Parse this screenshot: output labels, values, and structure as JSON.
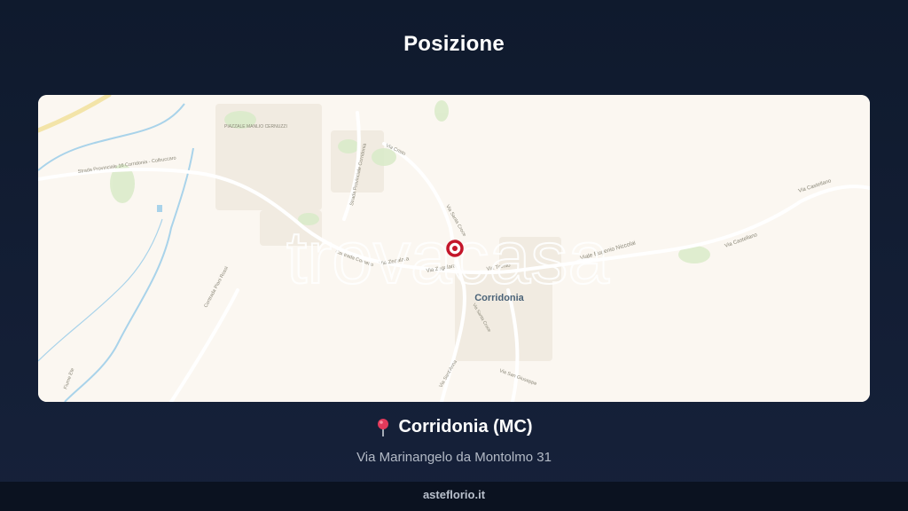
{
  "page": {
    "title": "Posizione"
  },
  "map": {
    "watermark": "trovacasa",
    "town_label": "Corridonia",
    "labels": [
      "PIAZZALE MANLIO CERNUZZI",
      "Strada Provinciale 16 Corridonia - Colbuccaro",
      "Strada Provinciale Corridonia",
      "Via Cristo",
      "Via Santa Croce",
      "Via Zegalara",
      "Via Zegalara",
      "Contrada Cornetto",
      "Via Trento",
      "Viale Eugenio Niccolai",
      "Via Castellano",
      "Via Castellano",
      "Contrada Piani Rossi",
      "Fiume Ete",
      "Via Santa Croce",
      "Via Sant'Anna",
      "Via San Giuseppe"
    ],
    "marker_icon": "location-marker-icon",
    "colors": {
      "background": "#fbf7f1",
      "marker": "#c4162a",
      "water": "#a9d3ea",
      "park": "#d5e8c4"
    }
  },
  "location": {
    "pin_icon": "pushpin-icon",
    "name": "Corridonia (MC)",
    "address": "Via Marinangelo da Montolmo 31"
  },
  "footer": {
    "site": "asteflorio.it"
  }
}
